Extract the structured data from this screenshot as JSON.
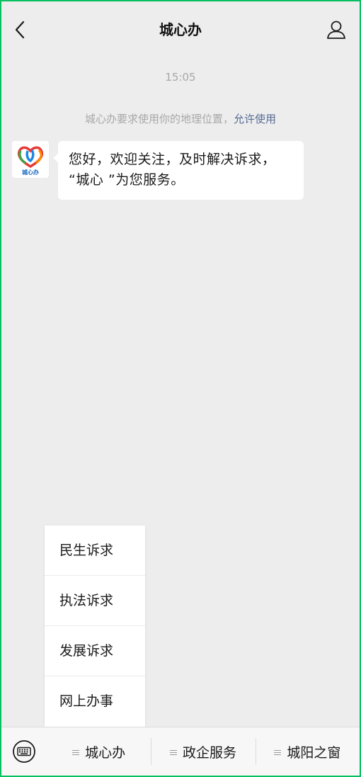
{
  "nav": {
    "title": "城心办",
    "back_icon": "chevron-left-icon",
    "profile_icon": "person-icon"
  },
  "chat": {
    "timestamp": "15:05",
    "system_message": "城心办要求使用你的地理位置，",
    "system_action": "允许使用",
    "message_line1": "您好，欢迎关注，及时解决诉求，",
    "message_line2": "“城心 ”为您服务。",
    "avatar_text": "城心办"
  },
  "popup_menu": {
    "items": [
      "民生诉求",
      "执法诉求",
      "发展诉求",
      "网上办事"
    ]
  },
  "bottom_menu": {
    "keyboard_icon": "keyboard-icon",
    "items": [
      "城心办",
      "政企服务",
      "城阳之窗"
    ]
  },
  "colors": {
    "frame_border": "#07c160",
    "background": "#ededed",
    "link": "#576b95",
    "muted_text": "#a8a8a8"
  }
}
